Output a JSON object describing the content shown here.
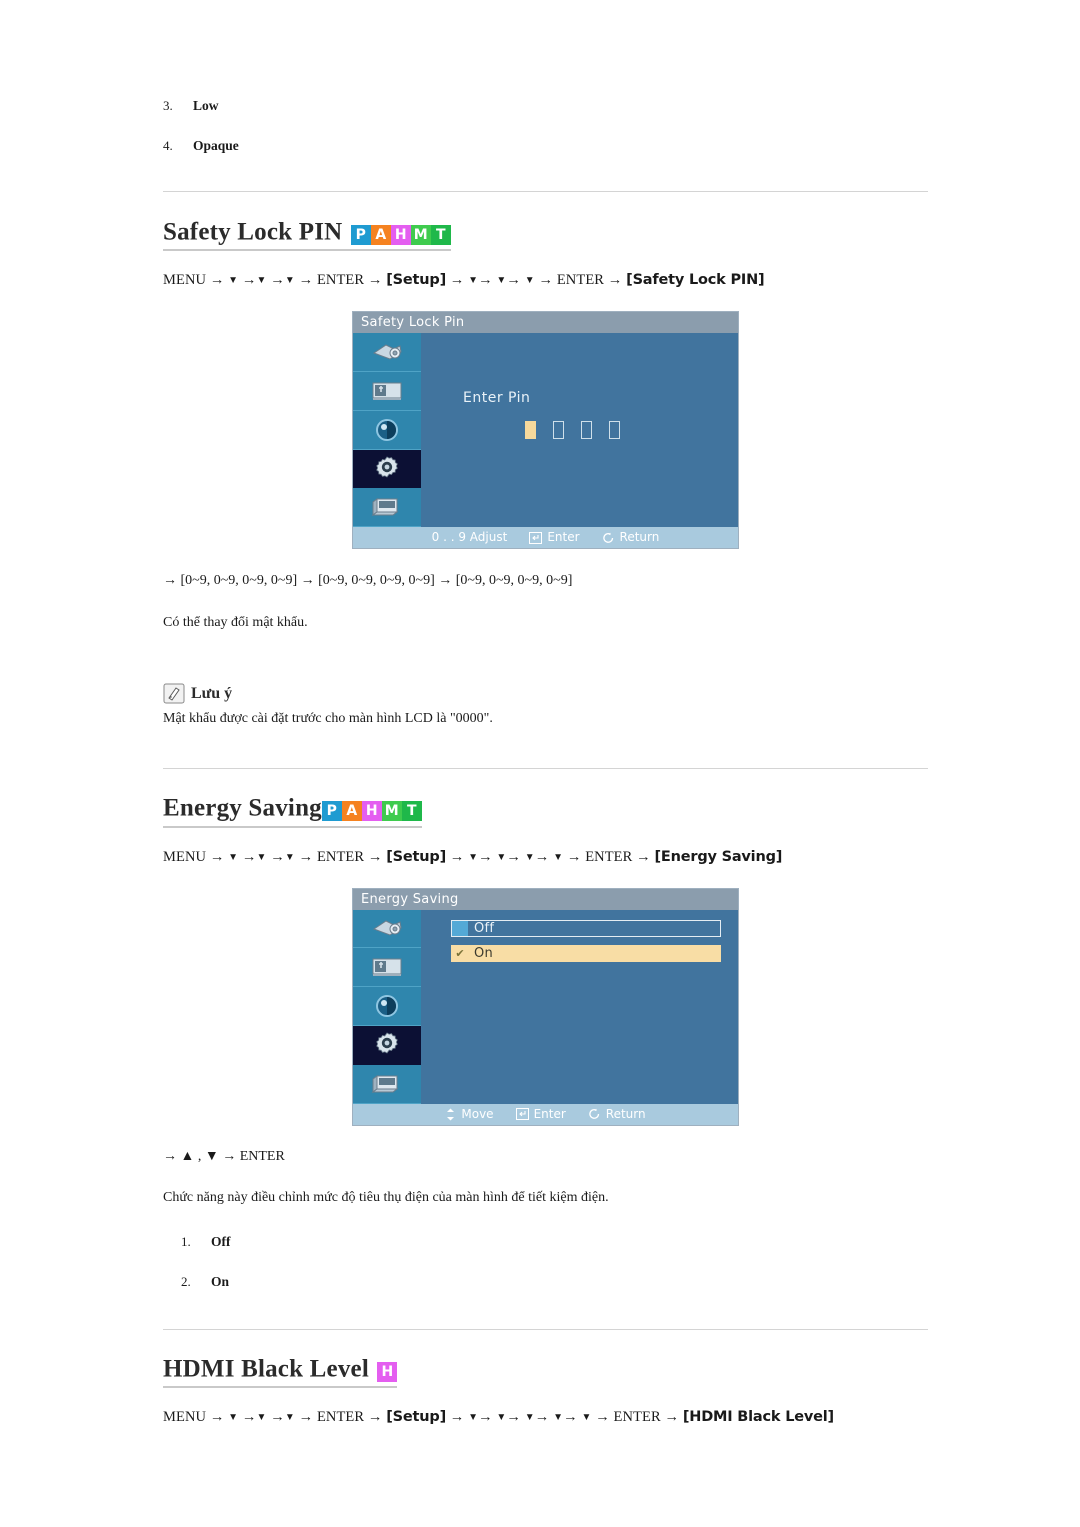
{
  "page": {
    "top_list": [
      {
        "index": "3.",
        "label": "Low"
      },
      {
        "index": "4.",
        "label": "Opaque"
      }
    ],
    "badge_colors": {
      "P": "#1f9bd1",
      "A": "#f58220",
      "H": "#e45ef0",
      "M": "#3fcb4e",
      "T": "#1fb84a",
      "H_only": "#e45ef0"
    },
    "sections": [
      {
        "id": "safety-lock-pin",
        "title": "Safety Lock PIN",
        "badges": [
          "P",
          "A",
          "H",
          "M",
          "T"
        ],
        "nav": {
          "start": "MENU",
          "steps_1": [
            "▼",
            "▼",
            "▼"
          ],
          "enter_1": "ENTER",
          "menu_label": "[Setup]",
          "steps_2": [
            "▼",
            "▼",
            "▼"
          ],
          "enter_2": "ENTER",
          "target_label": "[Safety Lock PIN]"
        },
        "osd": {
          "title": "Safety Lock Pin",
          "pin_label": "Enter  Pin",
          "pin_boxes": [
            true,
            false,
            false,
            false
          ],
          "footer": [
            {
              "icon": "none",
              "label": "0 . . 9  Adjust"
            },
            {
              "icon": "enter-icon",
              "label": "Enter"
            },
            {
              "icon": "return-icon",
              "label": "Return"
            }
          ]
        },
        "after_lines": [
          "→ [0~9, 0~9, 0~9, 0~9] → [0~9, 0~9, 0~9, 0~9] → [0~9, 0~9, 0~9, 0~9]",
          "Có thể thay đổi mật khẩu."
        ],
        "note": {
          "heading": "Lưu ý",
          "body": "Mật khẩu được cài đặt trước cho màn hình LCD là \"0000\"."
        }
      },
      {
        "id": "energy-saving",
        "title": "Energy Saving",
        "badges": [
          "P",
          "A",
          "H",
          "M",
          "T"
        ],
        "nav": {
          "start": "MENU",
          "steps_1": [
            "▼",
            "▼",
            "▼"
          ],
          "enter_1": "ENTER",
          "menu_label": "[Setup]",
          "steps_2": [
            "▼",
            "▼",
            "▼",
            "▼"
          ],
          "enter_2": "ENTER",
          "target_label": "[Energy Saving]"
        },
        "osd": {
          "title": "Energy Saving",
          "options": [
            {
              "label": "Off",
              "selected": false,
              "mark": ""
            },
            {
              "label": "On",
              "selected": true,
              "mark": "✔"
            }
          ],
          "footer": [
            {
              "icon": "move-icon",
              "label": "Move"
            },
            {
              "icon": "enter-icon",
              "label": "Enter"
            },
            {
              "icon": "return-icon",
              "label": "Return"
            }
          ]
        },
        "after_lines": [
          "→ ▲ , ▼ → ENTER",
          "Chức năng này điều chỉnh mức độ tiêu thụ điện của màn hình để tiết kiệm điện."
        ],
        "list": [
          {
            "index": "1.",
            "label": "Off"
          },
          {
            "index": "2.",
            "label": "On"
          }
        ]
      },
      {
        "id": "hdmi-black-level",
        "title": "HDMI Black Level",
        "badges": [
          "H"
        ],
        "nav": {
          "start": "MENU",
          "steps_1": [
            "▼",
            "▼",
            "▼"
          ],
          "enter_1": "ENTER",
          "menu_label": "[Setup]",
          "steps_2": [
            "▼",
            "▼",
            "▼",
            "▼",
            "▼"
          ],
          "enter_2": "ENTER",
          "target_label": "[HDMI Black Level]"
        }
      }
    ]
  }
}
